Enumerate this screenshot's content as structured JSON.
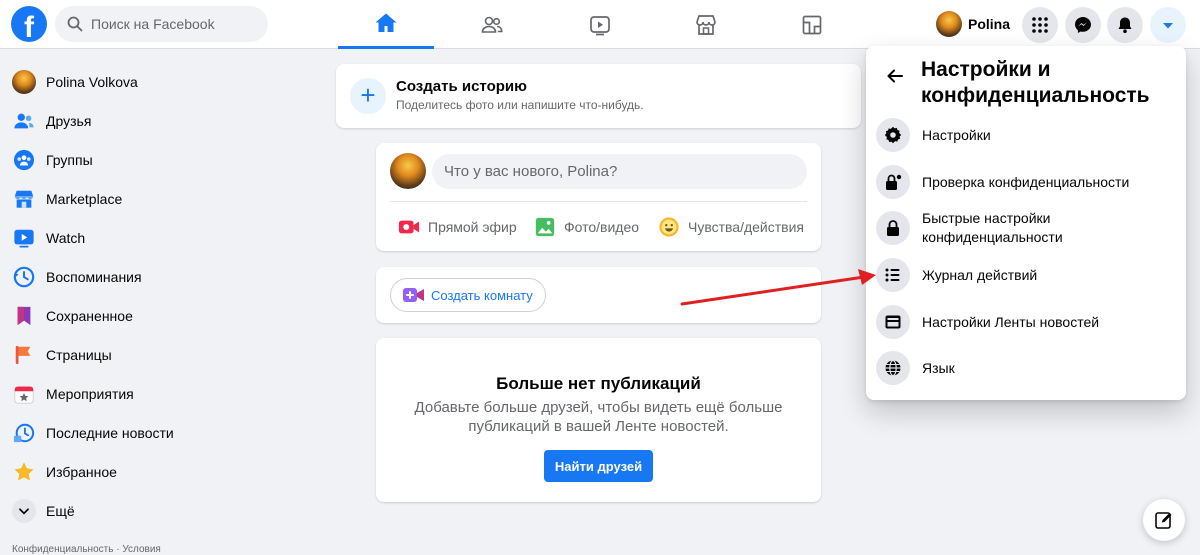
{
  "search": {
    "placeholder": "Поиск на Facebook"
  },
  "header": {
    "logo_letter": "f",
    "profile_name": "Polina"
  },
  "sidebar": {
    "items": [
      {
        "label": "Polina Volkova",
        "icon": "avatar"
      },
      {
        "label": "Друзья",
        "icon": "friends-icon"
      },
      {
        "label": "Группы",
        "icon": "groups-icon"
      },
      {
        "label": "Marketplace",
        "icon": "marketplace-icon"
      },
      {
        "label": "Watch",
        "icon": "watch-icon"
      },
      {
        "label": "Воспоминания",
        "icon": "memories-icon"
      },
      {
        "label": "Сохраненное",
        "icon": "saved-icon"
      },
      {
        "label": "Страницы",
        "icon": "pages-icon"
      },
      {
        "label": "Мероприятия",
        "icon": "events-icon"
      },
      {
        "label": "Последние новости",
        "icon": "recent-news-icon"
      },
      {
        "label": "Избранное",
        "icon": "favorites-icon"
      },
      {
        "label": "Ещё",
        "icon": "chevron-down-icon"
      }
    ],
    "footer": "Конфиденциальность · Условия"
  },
  "story": {
    "title": "Создать историю",
    "subtitle": "Поделитесь фото или напишите что-нибудь."
  },
  "composer": {
    "placeholder": "Что у вас нового, Polina?",
    "actions": [
      {
        "label": "Прямой эфир",
        "icon": "live-video-icon",
        "color": "#f02849"
      },
      {
        "label": "Фото/видео",
        "icon": "photo-icon",
        "color": "#45bd62"
      },
      {
        "label": "Чувства/действия",
        "icon": "feeling-icon",
        "color": "#f7b928"
      }
    ]
  },
  "room": {
    "label": "Создать комнату"
  },
  "empty_feed": {
    "title": "Больше нет публикаций",
    "text": "Добавьте больше друзей, чтобы видеть ещё больше публикаций в вашей Ленте новостей.",
    "button": "Найти друзей"
  },
  "dropdown": {
    "title": "Настройки и конфиденциальность",
    "items": [
      {
        "label": "Настройки",
        "icon": "gear-icon"
      },
      {
        "label": "Проверка конфиденциальности",
        "icon": "lock-check-icon"
      },
      {
        "label": "Быстрые настройки конфиденциальности",
        "icon": "lock-icon"
      },
      {
        "label": "Журнал действий",
        "icon": "list-icon"
      },
      {
        "label": "Настройки Ленты новостей",
        "icon": "news-feed-icon"
      },
      {
        "label": "Язык",
        "icon": "globe-icon"
      }
    ]
  },
  "colors": {
    "brand": "#1877f2",
    "annotation_arrow": "#e02020"
  }
}
